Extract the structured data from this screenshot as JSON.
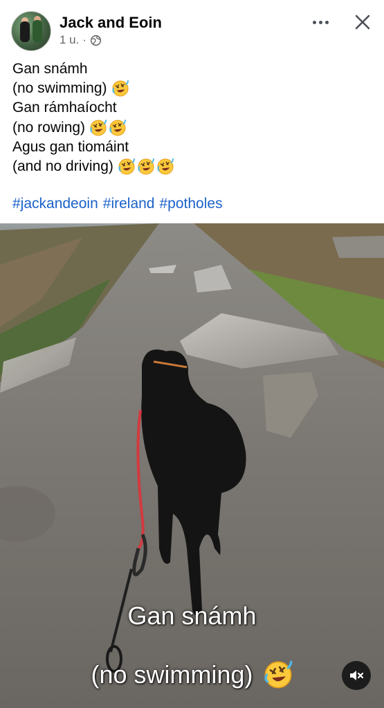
{
  "post": {
    "author": "Jack and Eoin",
    "time": "1 u.",
    "separator": "·",
    "audience_icon": "globe-icon",
    "more_icon": "more-options-icon",
    "close_icon": "close-icon"
  },
  "caption": {
    "lines": [
      {
        "text": "Gan snámh",
        "emoji_count": 0
      },
      {
        "text": "(no swimming)",
        "emoji_count": 1
      },
      {
        "text": "Gan rámhaíocht",
        "emoji_count": 0
      },
      {
        "text": "(no rowing)",
        "emoji_count": 2
      },
      {
        "text": "Agus gan tiomáint",
        "emoji_count": 0
      },
      {
        "text": "(and no driving)",
        "emoji_count": 3
      }
    ],
    "emoji_icon": "rolling-on-floor-laughing-emoji",
    "hashtags": [
      "#jackandeoin",
      "#ireland",
      "#potholes"
    ]
  },
  "video": {
    "subtitle_line1": "Gan snámh",
    "subtitle_line2": "(no swimming)",
    "subtitle_emoji": "rolling-on-floor-laughing-emoji",
    "mute_icon": "speaker-muted-icon"
  },
  "colors": {
    "text": "#050505",
    "secondary_text": "#65676b",
    "link": "#1b61c9",
    "background": "#ffffff"
  }
}
